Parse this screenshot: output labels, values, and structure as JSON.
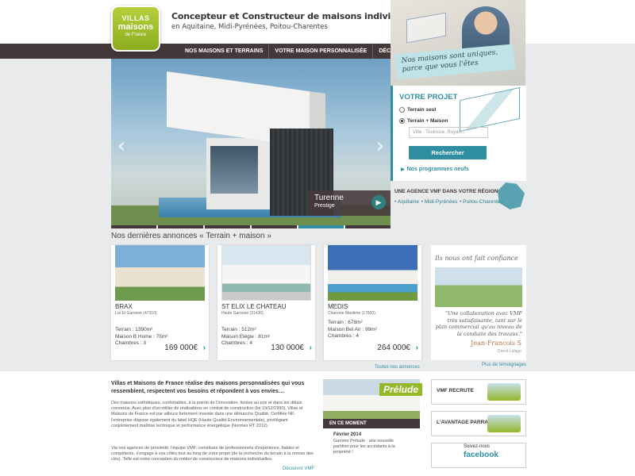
{
  "header": {
    "logo_line1": "VILLAS & maisons",
    "logo_line2": "maisons",
    "logo_line3": "de France",
    "title": "Concepteur et Constructeur de maisons individuelles",
    "subtitle": "en Aquitaine, Midi-Pyrénées, Poitou-Charentes",
    "banner": "Nos maisons sont uniques, parce que vous l'êtes"
  },
  "nav": [
    "NOS MAISONS ET TERRAINS",
    "VOTRE MAISON PERSONNALISÉE",
    "DÉCOUVRIR VMF"
  ],
  "slider": {
    "title": "Turenne",
    "subtitle": "Prestige",
    "prev": "‹",
    "next": "›",
    "go": "▶"
  },
  "projet": {
    "title": "VOTRE PROJET",
    "radio1": "Terrain seul",
    "radio2": "Terrain + Maison",
    "placeholder": "Ville : Toulouse, Royan...",
    "button": "Rechercher",
    "link": "Nos programmes neufs"
  },
  "agence": {
    "title": "UNE AGENCE VMF DANS VOTRE RÉGION",
    "links": [
      "Aquitaine",
      "Midi-Pyrénées",
      "Poitou-Charentes"
    ]
  },
  "annonces": {
    "title": "Nos dernières annonces « Terrain + maison »",
    "all_link": "Toutes nos annonces",
    "cards": [
      {
        "name": "BRAX",
        "loc": "Lot Et Garonne (47310)",
        "line1": "Terrain : 1390m²",
        "line2": "Maison B Home : 75m²",
        "line3": "Chambres : 3",
        "price": "169 000€"
      },
      {
        "name": "ST ELIX LE CHATEAU",
        "loc": "Haute Garonne (31430)",
        "line1": "Terrain : 512m²",
        "line2": "Maison Elégie : 81m²",
        "line3": "Chambres : 4",
        "price": "130 000€"
      },
      {
        "name": "MEDIS",
        "loc": "Charente Maritime (17600)",
        "line1": "Terrain : 678m²",
        "line2": "Maison Bel Air : 99m²",
        "line3": "Chambres : 4",
        "price": "264 000€"
      }
    ]
  },
  "temoignage": {
    "title": "Ils nous ont fait confiance",
    "quote": "\"Une collaboration avec VMF très satisfaisante, tant sur le plan commercial qu'au niveau de la conduite des travaux.\"",
    "name": "Jean-Francois S",
    "loc": "Drenil-Lafage",
    "more": "Plus de témoignages"
  },
  "intro": {
    "head": "Villas et Maisons de France réalise des maisons personnalisées qui vous ressemblent, respectent vos besoins et répondent à vos envies…",
    "p1": "Des maisons esthétiques, confortables, à la pointe de l'innovation, livrées au prix et dans les délais convenus. Avec plus d'un millier de réalisations en contrat de construction (loi 19/12/1990), Villas et Maisons de France est par ailleurs fortement investie dans une démarche Qualité. Certifiée NF, l'entreprise dispose également du label HQE (Haute Qualité Environnementale), privilégiant conjointement maîtrise technique et performance énergétique (Normes RT 2012).",
    "p2": "Via nos agences de proximité, l'équipe VMF, constituée de professionnels d'expérience, fiables et compétents, s'engage à vos côtés tout au long de votre projet (de la recherche du terrain à la remise des clés). Telle est notre conception du métier de constructeur de maisons individuelles.",
    "link": "Découvrir VMF"
  },
  "moment": {
    "badge": "Prélude",
    "bar": "EN CE MOMENT",
    "title": "Février 2014",
    "text": "Gamme Prélude : une nouvelle partition pour les accédants à la propriété !"
  },
  "promos": {
    "recrute": "VMF RECRUTE",
    "parrainage": "L'AVANTAGE PARRAINAGE",
    "suivez": "Suivez-nous",
    "facebook": "facebook"
  }
}
